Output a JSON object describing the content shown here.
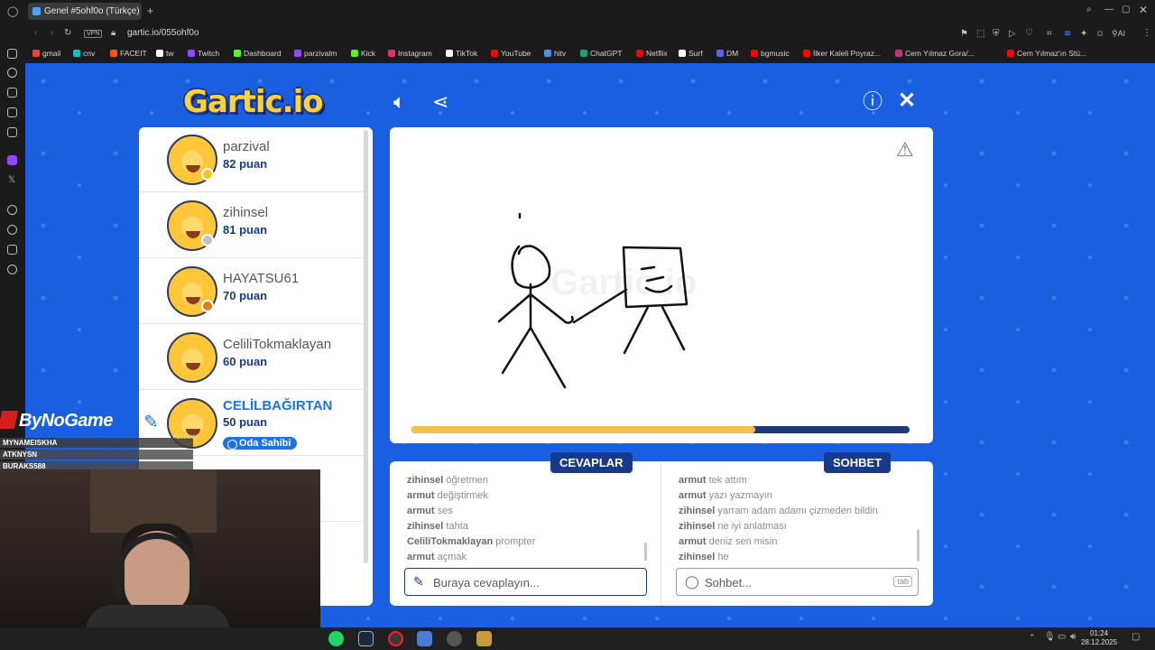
{
  "browser": {
    "tab_title": "Genel #5ohf0o (Türkçe) ·",
    "url": "gartic.io/055ohf0o",
    "vpn_label": "VPN",
    "ai_label": "AI",
    "bookmarks": [
      "gmail",
      "cnv",
      "FACEIT",
      "tw",
      "Twitch",
      "Dashboard",
      "parzivalm",
      "Kick",
      "Instagram",
      "TikTok",
      "YouTube",
      "hitv",
      "ChatGPT",
      "Netflix",
      "Surf",
      "DM",
      "bgmusic",
      "İlker Kaleli Poyraz...",
      "Cem Yılmaz Gora/...",
      "Cem Yılmaz'ın Stü..."
    ],
    "bookmark_colors": [
      "#ea4335",
      "#00c4cc",
      "#ff5500",
      "#ffffff",
      "#9146ff",
      "#53fc18",
      "#9146ff",
      "#53fc18",
      "#e1306c",
      "#ffffff",
      "#ff0000",
      "#4a90e2",
      "#10a37f",
      "#e50914",
      "#ffffff",
      "#5865f2",
      "#ff0000",
      "#ff0000",
      "#c13584",
      "#ff0000"
    ]
  },
  "game": {
    "logo": "Gartic.io",
    "canvas_watermark": "Gartic.io",
    "round_progress": 0.69,
    "players": [
      {
        "name": "parzival",
        "score": "82 puan",
        "status_color": "#f5c518",
        "drawing": false,
        "owner": ""
      },
      {
        "name": "zihinsel",
        "score": "81 puan",
        "status_color": "#c0c0c0",
        "drawing": false,
        "owner": ""
      },
      {
        "name": "HAYATSU61",
        "score": "70 puan",
        "status_color": "#e07a1f",
        "drawing": false,
        "owner": ""
      },
      {
        "name": "CeliliTokmaklayan",
        "score": "60 puan",
        "status_color": "",
        "drawing": false,
        "owner": ""
      },
      {
        "name": "CELİLBAĞIRTAN",
        "score": "50 puan",
        "status_color": "",
        "drawing": true,
        "owner": "Oda Sahibi"
      }
    ],
    "answers": {
      "title": "CEVAPLAR",
      "messages": [
        {
          "user": "zihinsel",
          "text": "öğretmen"
        },
        {
          "user": "armut",
          "text": "değiştirmek"
        },
        {
          "user": "armut",
          "text": "ses"
        },
        {
          "user": "zihinsel",
          "text": "tahta"
        },
        {
          "user": "CeliliTokmaklayan",
          "text": "prompter"
        },
        {
          "user": "armut",
          "text": "açmak"
        }
      ],
      "placeholder": "Buraya cevaplayın..."
    },
    "chat": {
      "title": "SOHBET",
      "messages": [
        {
          "user": "armut",
          "text": "tek attım"
        },
        {
          "user": "armut",
          "text": "yazı yazmayın"
        },
        {
          "user": "zihinsel",
          "text": "yarram adam adamı çizmeden bildin"
        },
        {
          "user": "zihinsel",
          "text": "ne iyi anlatması"
        },
        {
          "user": "armut",
          "text": "deniz sen misin"
        },
        {
          "user": "zihinsel",
          "text": "he"
        }
      ],
      "placeholder": "Sohbet...",
      "tab_hint": "tab"
    }
  },
  "stream": {
    "brand": "ByNoGame",
    "follow_label": "FOLLOW",
    "followers": [
      "MYNAMEISKHA",
      "ATKNYSN",
      "BURAKS588"
    ]
  },
  "taskbar": {
    "time": "01:24",
    "date": "28.12.2025"
  }
}
